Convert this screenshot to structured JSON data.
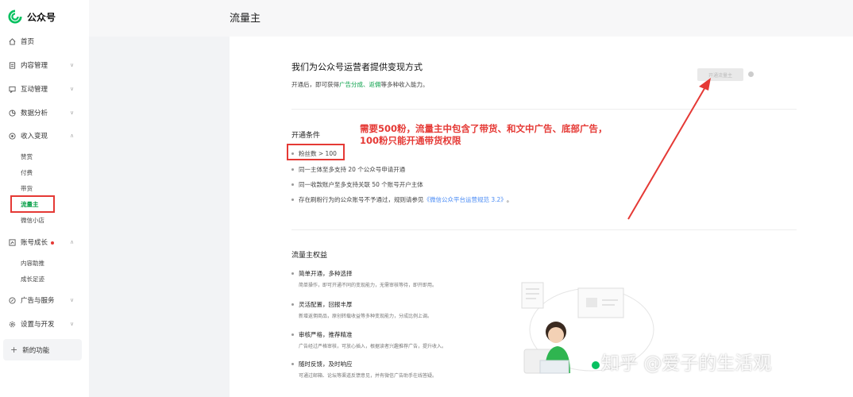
{
  "app": {
    "name": "公众号",
    "brand_color": "#07c160"
  },
  "sidebar": {
    "items": [
      {
        "label": "首页",
        "icon": "home-icon"
      },
      {
        "label": "内容管理",
        "icon": "document-icon"
      },
      {
        "label": "互动管理",
        "icon": "chat-icon"
      },
      {
        "label": "数据分析",
        "icon": "analytics-icon"
      },
      {
        "label": "收入变现",
        "icon": "income-icon"
      },
      {
        "label": "账号成长",
        "icon": "growth-icon"
      },
      {
        "label": "广告与服务",
        "icon": "ad-icon"
      },
      {
        "label": "设置与开发",
        "icon": "settings-icon"
      }
    ],
    "income_sub": [
      "赞赏",
      "付费",
      "带货",
      "流量主",
      "微信小店"
    ],
    "growth_sub": [
      "内容助推",
      "成长足迹"
    ],
    "new_features": "新的功能"
  },
  "header": {
    "title": "流量主"
  },
  "main": {
    "heading": "我们为公众号运营者提供变现方式",
    "desc_prefix": "开通后，即可获得",
    "desc_link1": "广告分成",
    "desc_sep": "、",
    "desc_link2": "返佣",
    "desc_suffix": "等多种收入能力。",
    "open_button": "开通流量主",
    "conditions_title": "开通条件",
    "conditions": [
      "粉丝数 > 100",
      "同一主体至多支持 20 个公众号申请开通",
      "同一收款账户至多支持关联 50 个账号开户主体"
    ],
    "condition_last_prefix": "存在刷粉行为的公众账号不予通过，规则请参见",
    "condition_last_link": "《微信公众平台运营规范 3.2》",
    "condition_last_suffix": "。",
    "annotation_line1": "需要500粉，流量主中包含了带货、和文中广告、底部广告，",
    "annotation_line2": "100粉只能开通带货权限",
    "benefits_title": "流量主权益",
    "benefits": [
      {
        "title": "简单开通，多种选择",
        "desc": "简单操作，即可开通不同的变现能力，无需审核等待，即开即用。"
      },
      {
        "title": "灵活配置，回报丰厚",
        "desc": "新增返佣商品，原创转载收益等多种变现能力，分成比例上调。"
      },
      {
        "title": "审核严格，推荐精准",
        "desc": "广告经过严格审核，可放心插入，根据读者兴趣推荐广告，提升收入。"
      },
      {
        "title": "随时反馈，及时响应",
        "desc": "可通过邮箱、论坛等渠道反馈意见，并有微信广告助手在线答疑。"
      }
    ]
  },
  "watermark": "知乎 @爱子的生活观"
}
